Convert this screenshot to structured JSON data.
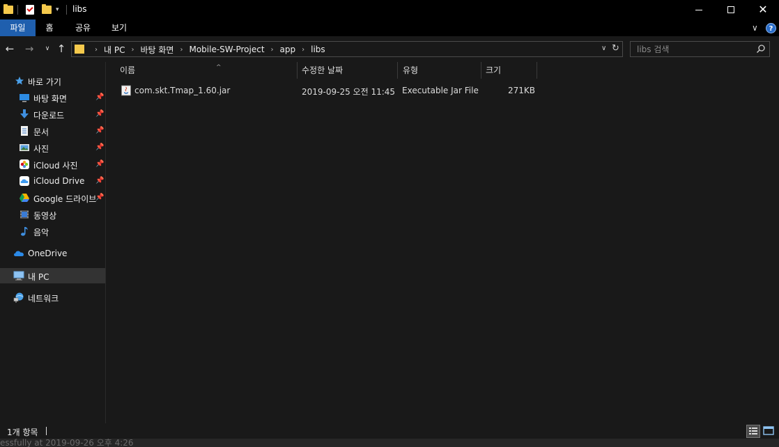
{
  "window": {
    "title": "libs"
  },
  "ribbon": {
    "tabs": [
      "파일",
      "홈",
      "공유",
      "보기"
    ],
    "help_label": "?"
  },
  "nav": {
    "breadcrumbs": [
      "내 PC",
      "바탕 화면",
      "Mobile-SW-Project",
      "app",
      "libs"
    ],
    "search_placeholder": "libs 검색"
  },
  "sidebar": {
    "quick_access": "바로 가기",
    "items": [
      {
        "label": "바탕 화면",
        "icon": "desktop-icon",
        "pinned": true
      },
      {
        "label": "다운로드",
        "icon": "download-icon",
        "pinned": true
      },
      {
        "label": "문서",
        "icon": "document-icon",
        "pinned": true
      },
      {
        "label": "사진",
        "icon": "pictures-icon",
        "pinned": true
      },
      {
        "label": "iCloud 사진",
        "icon": "icloud-photos-icon",
        "pinned": true
      },
      {
        "label": "iCloud Drive",
        "icon": "icloud-drive-icon",
        "pinned": true
      },
      {
        "label": "Google 드라이브",
        "icon": "google-drive-icon",
        "pinned": true
      },
      {
        "label": "동영상",
        "icon": "videos-icon",
        "pinned": false
      },
      {
        "label": "음악",
        "icon": "music-icon",
        "pinned": false
      }
    ],
    "onedrive": "OneDrive",
    "this_pc": "내 PC",
    "network": "네트워크"
  },
  "columns": {
    "name": "이름",
    "modified": "수정한 날짜",
    "type": "유형",
    "size": "크기"
  },
  "files": [
    {
      "name": "com.skt.Tmap_1.60.jar",
      "modified": "2019-09-25 오전 11:45",
      "type": "Executable Jar File",
      "size": "271KB"
    }
  ],
  "status": {
    "item_count": "1개 항목",
    "background_text": "essfully at 2019-09-26 오후 4:26"
  },
  "colors": {
    "accent": "#1f5fae",
    "background": "#191919",
    "folder": "#f5c94c"
  }
}
